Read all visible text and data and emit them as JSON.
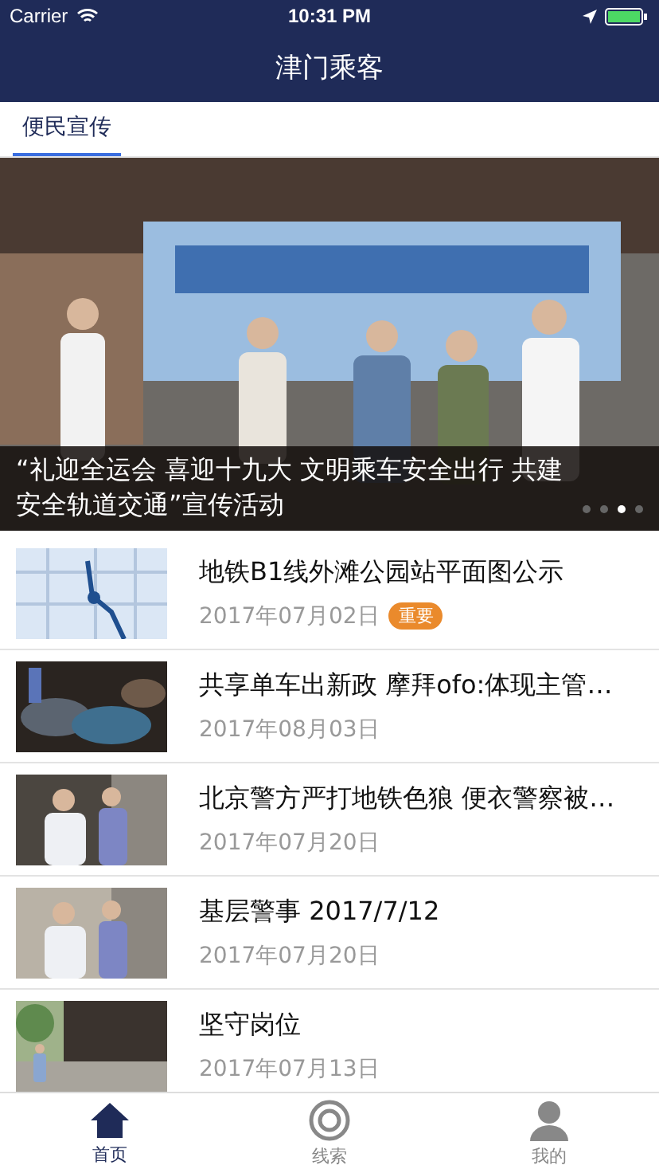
{
  "status_bar": {
    "carrier": "Carrier",
    "time": "10:31 PM"
  },
  "nav_bar": {
    "title": "津门乘客"
  },
  "tabs": [
    {
      "label": "便民宣传",
      "selected": true
    }
  ],
  "banner": {
    "caption": "“礼迎全运会 喜迎十九大 文明乘车安全出行 共建安全轨道交通”宣传活动",
    "pages": [
      {
        "selected": false
      },
      {
        "selected": false
      },
      {
        "selected": true
      },
      {
        "selected": false
      }
    ]
  },
  "news": [
    {
      "title": "地铁B1线外滩公园站平面图公示",
      "date": "2017年07月02日",
      "badge": "重要"
    },
    {
      "kind": "picture",
      "title": "共享单车出新政 摩拜ofo:体现主管…",
      "date": "2017年08月03日"
    },
    {
      "title": "北京警方严打地铁色狼 便衣警察被…",
      "date": "2017年07月20日"
    },
    {
      "title": "基层警事 2017/7/12",
      "date": "2017年07月20日"
    },
    {
      "title": "坚守岗位",
      "date": "2017年07月13日"
    }
  ],
  "tab_bar": [
    {
      "label": "首页",
      "kind": "home",
      "selected": true
    },
    {
      "label": "线索",
      "kind": "target",
      "selected": false
    },
    {
      "label": "我的",
      "kind": "person",
      "selected": false
    }
  ]
}
